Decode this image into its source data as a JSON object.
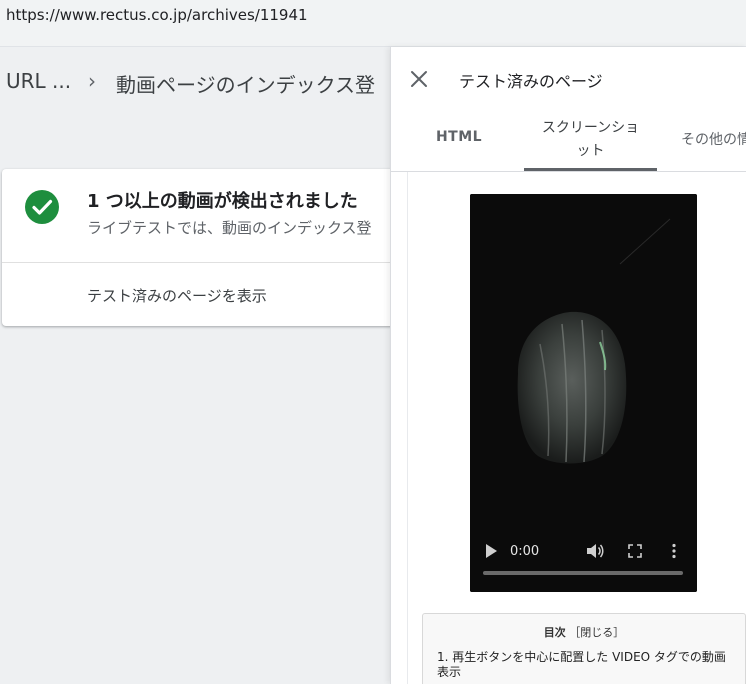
{
  "address_bar": {
    "url": "https://www.rectus.co.jp/archives/11941"
  },
  "breadcrumb": {
    "root": "URL ...",
    "separator": "›",
    "current": "動画ページのインデックス登"
  },
  "result_card": {
    "title": "1 つ以上の動画が検出されました",
    "subtitle": "ライブテストでは、動画のインデックス登",
    "view_tested_label": "テスト済みのページを表示",
    "status_color": "#1e8e3e"
  },
  "panel": {
    "title": "テスト済みのページ",
    "tabs": [
      {
        "label": "HTML",
        "selected": false
      },
      {
        "label_line1": "スクリーンショ",
        "label_line2": "ット",
        "selected": true
      },
      {
        "label": "その他の情",
        "selected": false
      }
    ]
  },
  "video": {
    "time": "0:00",
    "progress": 0.0,
    "icons": [
      "play-icon",
      "volume-icon",
      "fullscreen-icon",
      "more-icon"
    ]
  },
  "toc": {
    "title": "目次",
    "toggle": "［閉じる］",
    "items": [
      "1. 再生ボタンを中心に配置した VIDEO タグでの動画表示"
    ]
  }
}
